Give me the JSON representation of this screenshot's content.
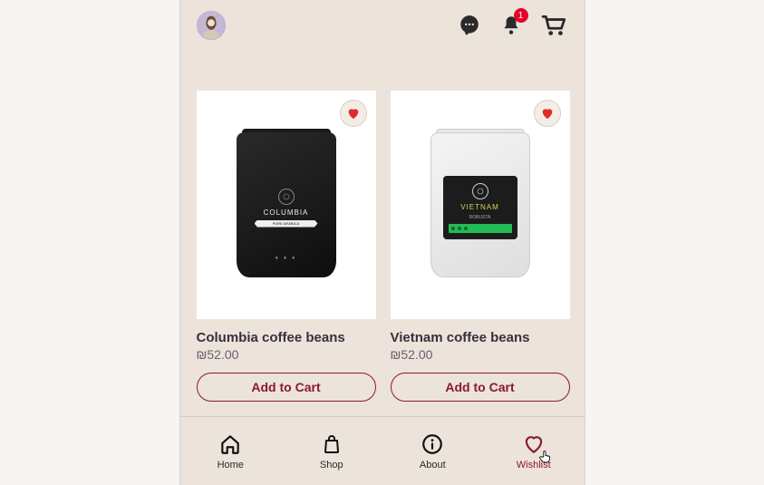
{
  "header": {
    "notification_count": "1"
  },
  "products": [
    {
      "name": "Columbia coffee beans",
      "price": "₪52.00",
      "cta": "Add to Cart",
      "bag_label": "COLUMBIA",
      "bag_sub": "PURE ARABICA"
    },
    {
      "name": "Vietnam coffee beans",
      "price": "₪52.00",
      "cta": "Add to Cart",
      "bag_label": "VIETNAM",
      "bag_sub": "ROBUSTA"
    }
  ],
  "nav": {
    "home": "Home",
    "shop": "Shop",
    "about": "About",
    "wishlist": "Wishlist"
  }
}
